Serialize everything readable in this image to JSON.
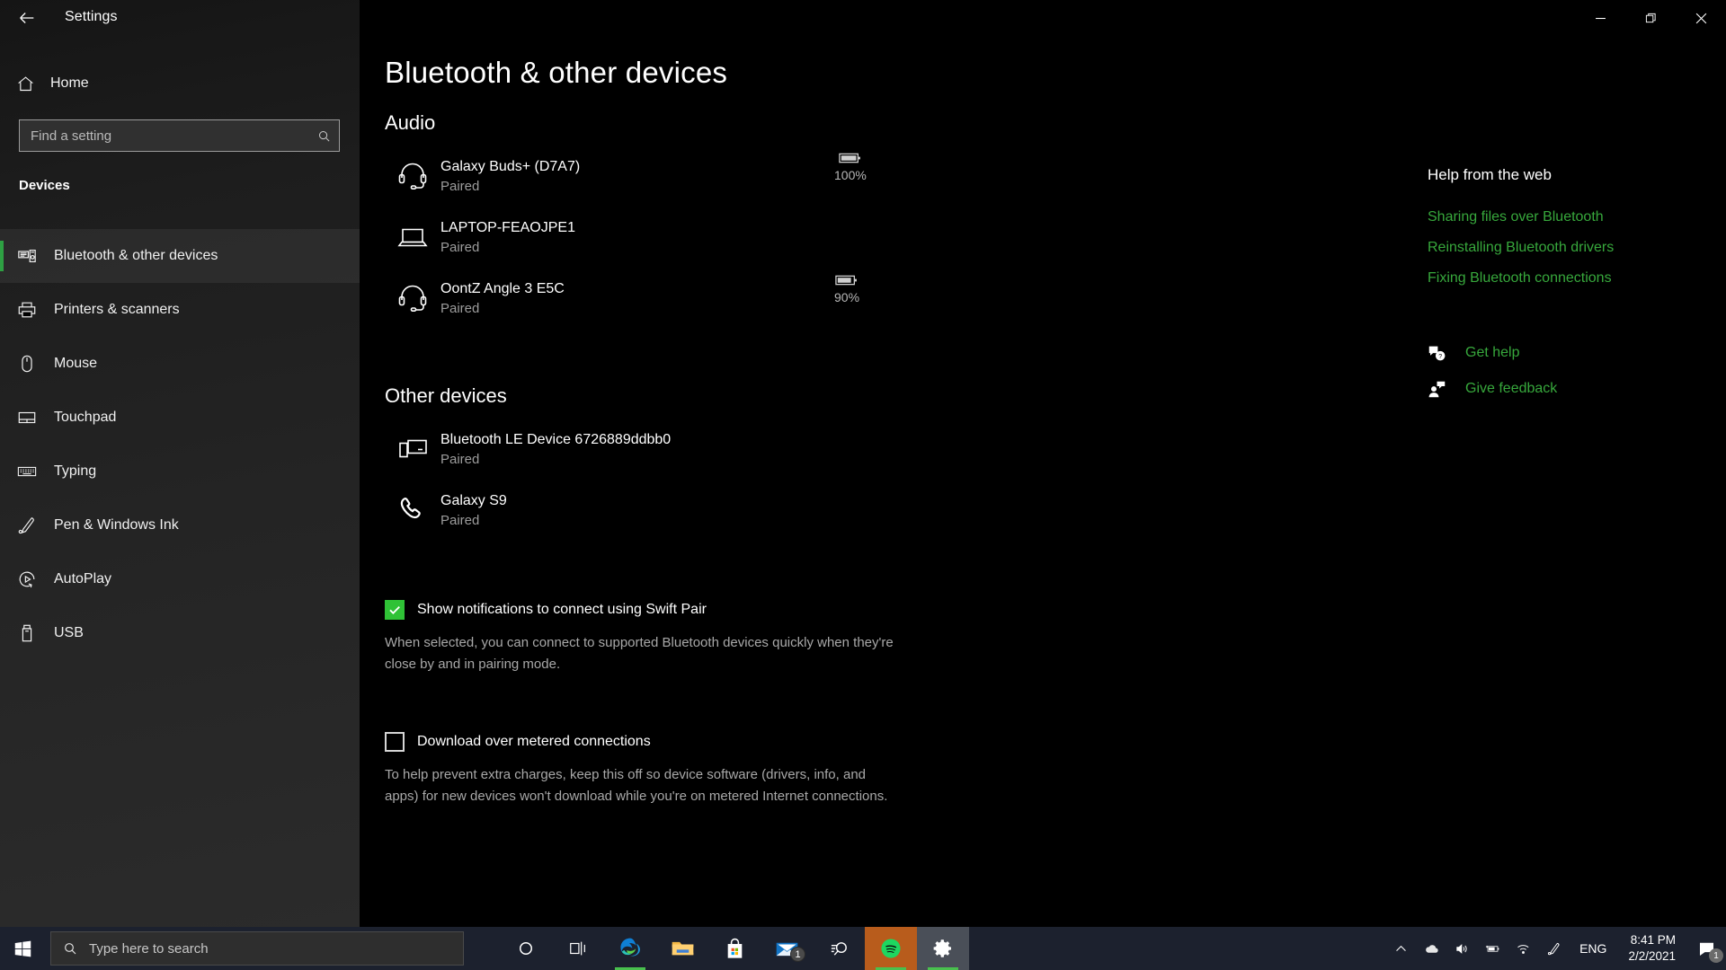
{
  "window": {
    "title": "Settings",
    "back_icon": "back-arrow-icon",
    "minimize_label": "Minimize",
    "maximize_label": "Restore",
    "close_label": "Close"
  },
  "sidebar": {
    "home_label": "Home",
    "home_icon": "home-icon",
    "search": {
      "placeholder": "Find a setting",
      "value": "",
      "icon": "search-icon"
    },
    "category": "Devices",
    "items": [
      {
        "label": "Bluetooth & other devices",
        "icon": "bluetooth-devices-icon",
        "active": true
      },
      {
        "label": "Printers & scanners",
        "icon": "printer-icon",
        "active": false
      },
      {
        "label": "Mouse",
        "icon": "mouse-icon",
        "active": false
      },
      {
        "label": "Touchpad",
        "icon": "touchpad-icon",
        "active": false
      },
      {
        "label": "Typing",
        "icon": "keyboard-icon",
        "active": false
      },
      {
        "label": "Pen & Windows Ink",
        "icon": "pen-icon",
        "active": false
      },
      {
        "label": "AutoPlay",
        "icon": "autoplay-icon",
        "active": false
      },
      {
        "label": "USB",
        "icon": "usb-icon",
        "active": false
      }
    ],
    "accent_color": "#2ea043"
  },
  "main": {
    "page_title": "Bluetooth & other devices",
    "groups": [
      {
        "heading": "Audio",
        "devices": [
          {
            "name": "Galaxy Buds+ (D7A7)",
            "status": "Paired",
            "icon": "headset-icon",
            "battery": "100%",
            "battery_level": 100
          },
          {
            "name": "LAPTOP-FEAOJPE1",
            "status": "Paired",
            "icon": "laptop-icon",
            "battery": null,
            "battery_level": null
          },
          {
            "name": "OontZ Angle 3 E5C",
            "status": "Paired",
            "icon": "headset-icon",
            "battery": "90%",
            "battery_level": 90
          }
        ]
      },
      {
        "heading": "Other devices",
        "devices": [
          {
            "name": "Bluetooth LE Device 6726889ddbb0",
            "status": "Paired",
            "icon": "phone-monitor-icon",
            "battery": null,
            "battery_level": null
          },
          {
            "name": "Galaxy S9",
            "status": "Paired",
            "icon": "phone-handset-icon",
            "battery": null,
            "battery_level": null
          }
        ]
      }
    ],
    "settings": [
      {
        "label": "Show notifications to connect using Swift Pair",
        "checked": true,
        "description": "When selected, you can connect to supported Bluetooth devices quickly when they're close by and in pairing mode."
      },
      {
        "label": "Download over metered connections",
        "checked": false,
        "description": "To help prevent extra charges, keep this off so device software (drivers, info, and apps) for new devices won't download while you're on metered Internet connections."
      }
    ],
    "checkbox_on_color": "#2fc236"
  },
  "help_panel": {
    "title": "Help from the web",
    "links": [
      "Sharing files over Bluetooth",
      "Reinstalling Bluetooth drivers",
      "Fixing Bluetooth connections"
    ],
    "actions": [
      {
        "label": "Get help",
        "icon": "question-bubble-icon"
      },
      {
        "label": "Give feedback",
        "icon": "feedback-person-icon"
      }
    ],
    "link_color": "#37a83c"
  },
  "taskbar": {
    "start_icon": "windows-start-icon",
    "search": {
      "placeholder": "Type here to search",
      "value": "",
      "icon": "search-icon"
    },
    "apps": [
      {
        "name": "Cortana",
        "icon": "cortana-circle-icon",
        "running": false,
        "badge": null
      },
      {
        "name": "Task View",
        "icon": "task-view-icon",
        "running": false,
        "badge": null
      },
      {
        "name": "Microsoft Edge",
        "icon": "edge-icon",
        "running": true,
        "badge": null
      },
      {
        "name": "File Explorer",
        "icon": "folder-icon",
        "running": false,
        "badge": null
      },
      {
        "name": "Microsoft Store",
        "icon": "store-bag-icon",
        "running": false,
        "badge": null
      },
      {
        "name": "Mail",
        "icon": "mail-envelope-icon",
        "running": false,
        "badge": "1"
      },
      {
        "name": "Search",
        "icon": "magnifier-app-icon",
        "running": false,
        "badge": null
      },
      {
        "name": "Spotify",
        "icon": "spotify-icon",
        "running": true,
        "badge": null
      },
      {
        "name": "Settings",
        "icon": "settings-gear-icon",
        "running": true,
        "badge": null
      }
    ],
    "tray": {
      "icons": [
        {
          "name": "show-hidden-icons-chevron-icon"
        },
        {
          "name": "onedrive-cloud-icon"
        },
        {
          "name": "volume-icon"
        },
        {
          "name": "battery-charging-icon"
        },
        {
          "name": "wifi-icon"
        },
        {
          "name": "pen-ink-icon"
        }
      ],
      "language": "ENG",
      "time": "8:41 PM",
      "date": "2/2/2021",
      "action_center_icon": "action-center-icon",
      "action_center_badge": "1"
    }
  }
}
